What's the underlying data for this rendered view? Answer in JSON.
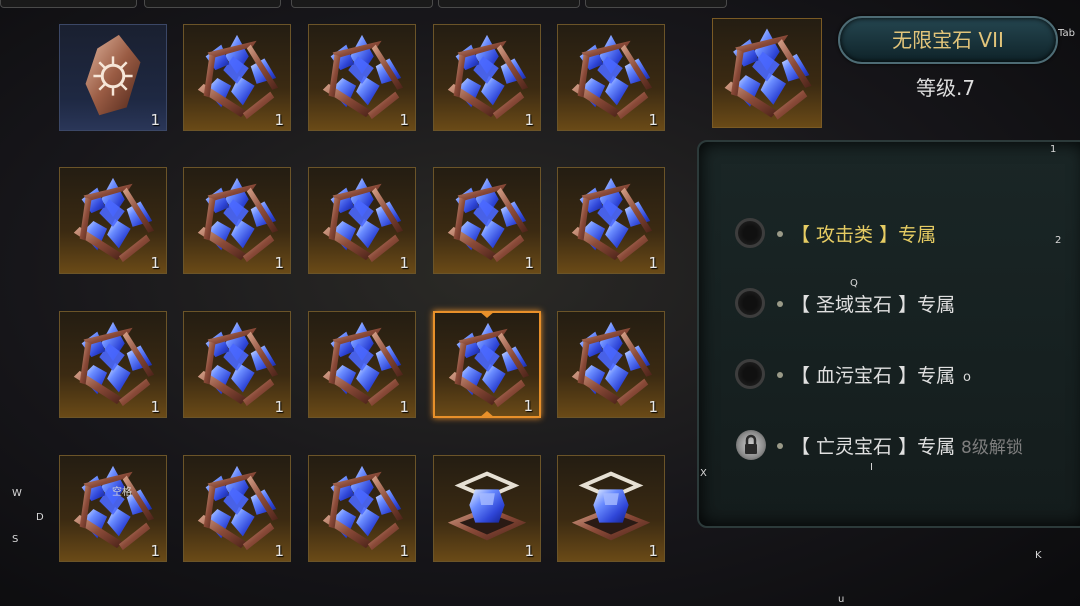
{
  "gem_name": "无限宝石 VII",
  "level": "等级.7",
  "hotkeys": {
    "tab": "Tab",
    "one": "1",
    "two": "2",
    "q": "Q",
    "o": "o",
    "x": "X",
    "i": "I",
    "w": "W",
    "d": "D",
    "s": "S",
    "k": "K",
    "u": "u",
    "space": "空格"
  },
  "inventory": [
    {
      "icon": "rune-stone-icon",
      "qty": "1"
    },
    {
      "icon": "infinity-gem-icon",
      "qty": "1"
    },
    {
      "icon": "infinity-gem-icon",
      "qty": "1"
    },
    {
      "icon": "infinity-gem-icon",
      "qty": "1"
    },
    {
      "icon": "infinity-gem-icon",
      "qty": "1"
    },
    {
      "icon": "infinity-gem-icon",
      "qty": "1"
    },
    {
      "icon": "infinity-gem-icon",
      "qty": "1"
    },
    {
      "icon": "infinity-gem-icon",
      "qty": "1"
    },
    {
      "icon": "infinity-gem-icon",
      "qty": "1"
    },
    {
      "icon": "infinity-gem-icon",
      "qty": "1"
    },
    {
      "icon": "infinity-gem-icon",
      "qty": "1"
    },
    {
      "icon": "infinity-gem-icon",
      "qty": "1"
    },
    {
      "icon": "infinity-gem-icon",
      "qty": "1"
    },
    {
      "icon": "infinity-gem-icon",
      "qty": "1",
      "selected": true
    },
    {
      "icon": "infinity-gem-icon",
      "qty": "1"
    },
    {
      "icon": "infinity-gem-icon",
      "qty": "1"
    },
    {
      "icon": "infinity-gem-icon",
      "qty": "1"
    },
    {
      "icon": "infinity-gem-icon",
      "qty": "1"
    },
    {
      "icon": "blue-crystal-frame-icon",
      "qty": "1"
    },
    {
      "icon": "blue-crystal-frame-icon",
      "qty": "1"
    }
  ],
  "options": [
    {
      "label": "【 攻击类 】专属",
      "state": "active"
    },
    {
      "label": "【 圣域宝石 】专属",
      "state": "normal"
    },
    {
      "label": "【 血污宝石 】专属",
      "state": "normal"
    },
    {
      "label": "【 亡灵宝石 】专属",
      "state": "locked",
      "note": "8级解锁"
    }
  ],
  "colors": {
    "accent": "#e8902a",
    "active_text": "#e6cc63",
    "title_text": "#e2c47a"
  }
}
